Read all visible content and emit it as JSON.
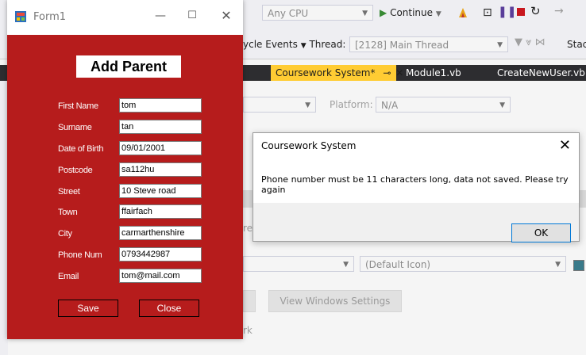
{
  "vs": {
    "cpu_combo": "Any CPU",
    "continue_label": "Continue",
    "lifecycle_label": "ycle Events",
    "thread_label": "Thread:",
    "thread_value": "[2128] Main Thread",
    "stack_label": "Stac",
    "tabs": [
      "Coursework System*",
      "Module1.vb",
      "CreateNewUser.vb [D"
    ],
    "platform_label": "Platform:",
    "platform_value": "N/A",
    "icon_combo": "(Default Icon)",
    "view_settings_button": "View Windows Settings",
    "partial_re": "re",
    "partial_rk": "rk"
  },
  "form1": {
    "title": "Form1",
    "heading": "Add Parent",
    "fields": [
      {
        "label": "First Name",
        "value": "tom"
      },
      {
        "label": "Surname",
        "value": "tan"
      },
      {
        "label": "Date of Birth",
        "value": "09/01/2001"
      },
      {
        "label": "Postcode",
        "value": "sa112hu"
      },
      {
        "label": "Street",
        "value": "10 Steve road"
      },
      {
        "label": "Town",
        "value": "ffairfach"
      },
      {
        "label": "City",
        "value": "carmarthenshire"
      },
      {
        "label": "Phone Num",
        "value": "0793442987"
      },
      {
        "label": "Email",
        "value": "tom@mail.com"
      }
    ],
    "save_label": "Save",
    "close_label": "Close"
  },
  "messagebox": {
    "title": "Coursework System",
    "message": "Phone number must be 11 characters long, data not saved. Please try again",
    "ok_label": "OK"
  },
  "colors": {
    "form_background": "#b61c1c",
    "vs_tab_active": "#ffcc33",
    "vs_tabbar": "#2d2d30"
  }
}
